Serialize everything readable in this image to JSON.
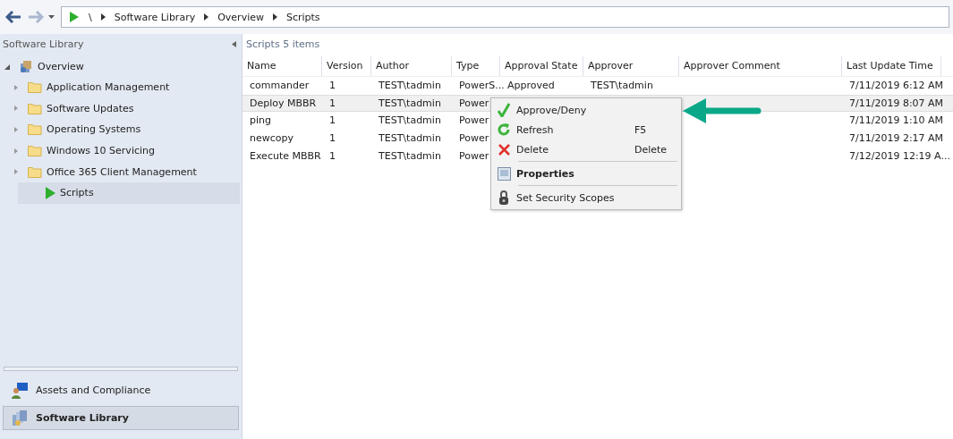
{
  "breadcrumb": [
    "\\",
    "Software Library",
    "Overview",
    "Scripts"
  ],
  "sidebar": {
    "title": "Software Library",
    "tree": [
      {
        "label": "Overview",
        "kind": "overview",
        "expanded": true,
        "children": [
          {
            "label": "Application Management",
            "kind": "folder",
            "expanded": false,
            "selected": false
          },
          {
            "label": "Software Updates",
            "kind": "folder",
            "expanded": false,
            "selected": false
          },
          {
            "label": "Operating Systems",
            "kind": "folder",
            "expanded": false,
            "selected": false
          },
          {
            "label": "Windows 10 Servicing",
            "kind": "folder",
            "expanded": false,
            "selected": false
          },
          {
            "label": "Office 365 Client Management",
            "kind": "folder",
            "expanded": false,
            "selected": false
          },
          {
            "label": "Scripts",
            "kind": "scripts",
            "selected": true
          }
        ]
      }
    ]
  },
  "workspaces": [
    {
      "label": "Assets and Compliance",
      "kind": "assets",
      "selected": false
    },
    {
      "label": "Software Library",
      "kind": "library",
      "selected": true
    }
  ],
  "list": {
    "title": "Scripts 5 items",
    "columns": [
      "Name",
      "Version",
      "Author",
      "Type",
      "Approval State",
      "Approver",
      "Approver Comment",
      "Last Update Time"
    ],
    "rows": [
      {
        "selected": false,
        "cells": [
          "commander",
          "1",
          "TEST\\tadmin",
          "PowerS...",
          "Approved",
          "TEST\\tadmin",
          "",
          "7/11/2019 6:12 AM"
        ]
      },
      {
        "selected": true,
        "cells": [
          "Deploy MBBR",
          "1",
          "TEST\\tadmin",
          "Power",
          "",
          "",
          "",
          "7/11/2019 8:07 AM"
        ]
      },
      {
        "selected": false,
        "cells": [
          "ping",
          "1",
          "TEST\\tadmin",
          "Power",
          "",
          "",
          "",
          "7/11/2019 1:10 AM"
        ]
      },
      {
        "selected": false,
        "cells": [
          "newcopy",
          "1",
          "TEST\\tadmin",
          "Power",
          "",
          "",
          "",
          "7/11/2019 2:17 AM"
        ]
      },
      {
        "selected": false,
        "cells": [
          "Execute MBBR",
          "1",
          "TEST\\tadmin",
          "Power",
          "",
          "",
          "",
          "7/12/2019 12:19 A..."
        ]
      }
    ]
  },
  "context_menu": [
    {
      "kind": "approve",
      "label": "Approve/Deny",
      "bold": false
    },
    {
      "kind": "refresh",
      "label": "Refresh",
      "shortcut": "F5",
      "bold": false
    },
    {
      "kind": "delete",
      "label": "Delete",
      "shortcut": "Delete",
      "bold": false
    },
    {
      "kind": "separator"
    },
    {
      "kind": "properties",
      "label": "Properties",
      "bold": true
    },
    {
      "kind": "separator"
    },
    {
      "kind": "scopes",
      "label": "Set Security Scopes",
      "bold": false
    }
  ]
}
